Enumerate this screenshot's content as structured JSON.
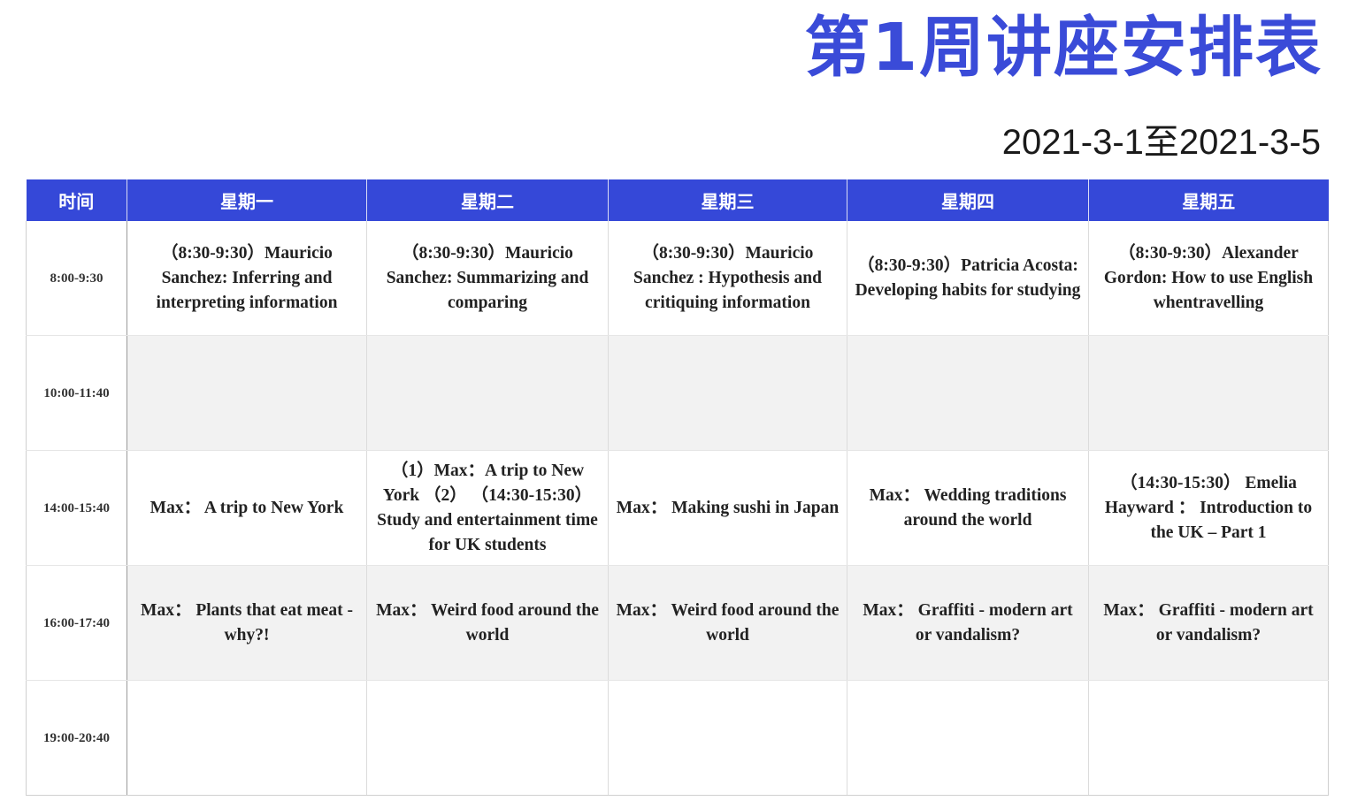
{
  "title": "第1周讲座安排表",
  "date_range": "2021-3-1至2021-3-5",
  "colors": {
    "title": "#3a4bd8",
    "header_bg": "#3548d8",
    "header_text": "#ffffff",
    "row_shade": "#f2f2f2"
  },
  "table": {
    "headers": [
      "时间",
      "星期一",
      "星期二",
      "星期三",
      "星期四",
      "星期五"
    ],
    "rows": [
      {
        "time": "8:00-9:30",
        "cells": [
          "（8:30-9:30）Mauricio Sanchez: Inferring and interpreting information",
          "（8:30-9:30）Mauricio Sanchez: Summarizing and comparing",
          "（8:30-9:30）Mauricio Sanchez : Hypothesis and critiquing information",
          "（8:30-9:30）Patricia Acosta: Developing habits for studying",
          "（8:30-9:30）Alexander Gordon: How to use English whentravelling"
        ]
      },
      {
        "time": "10:00-11:40",
        "cells": [
          "",
          "",
          "",
          "",
          ""
        ]
      },
      {
        "time": "14:00-15:40",
        "cells": [
          "Max： A trip to New York",
          "（1）Max：A trip to New York （2） （14:30-15:30） Study and entertainment time for UK students",
          "Max： Making sushi in Japan",
          "Max： Wedding traditions around the world",
          "（14:30-15:30） Emelia Hayward ： Introduction to the UK – Part 1"
        ]
      },
      {
        "time": "16:00-17:40",
        "cells": [
          "Max： Plants that eat meat - why?!",
          "Max： Weird food around the world",
          "Max： Weird food around the world",
          "Max： Graffiti - modern art or vandalism?",
          "Max： Graffiti - modern art or vandalism?"
        ]
      },
      {
        "time": "19:00-20:40",
        "cells": [
          "",
          "",
          "",
          "",
          ""
        ]
      }
    ]
  }
}
